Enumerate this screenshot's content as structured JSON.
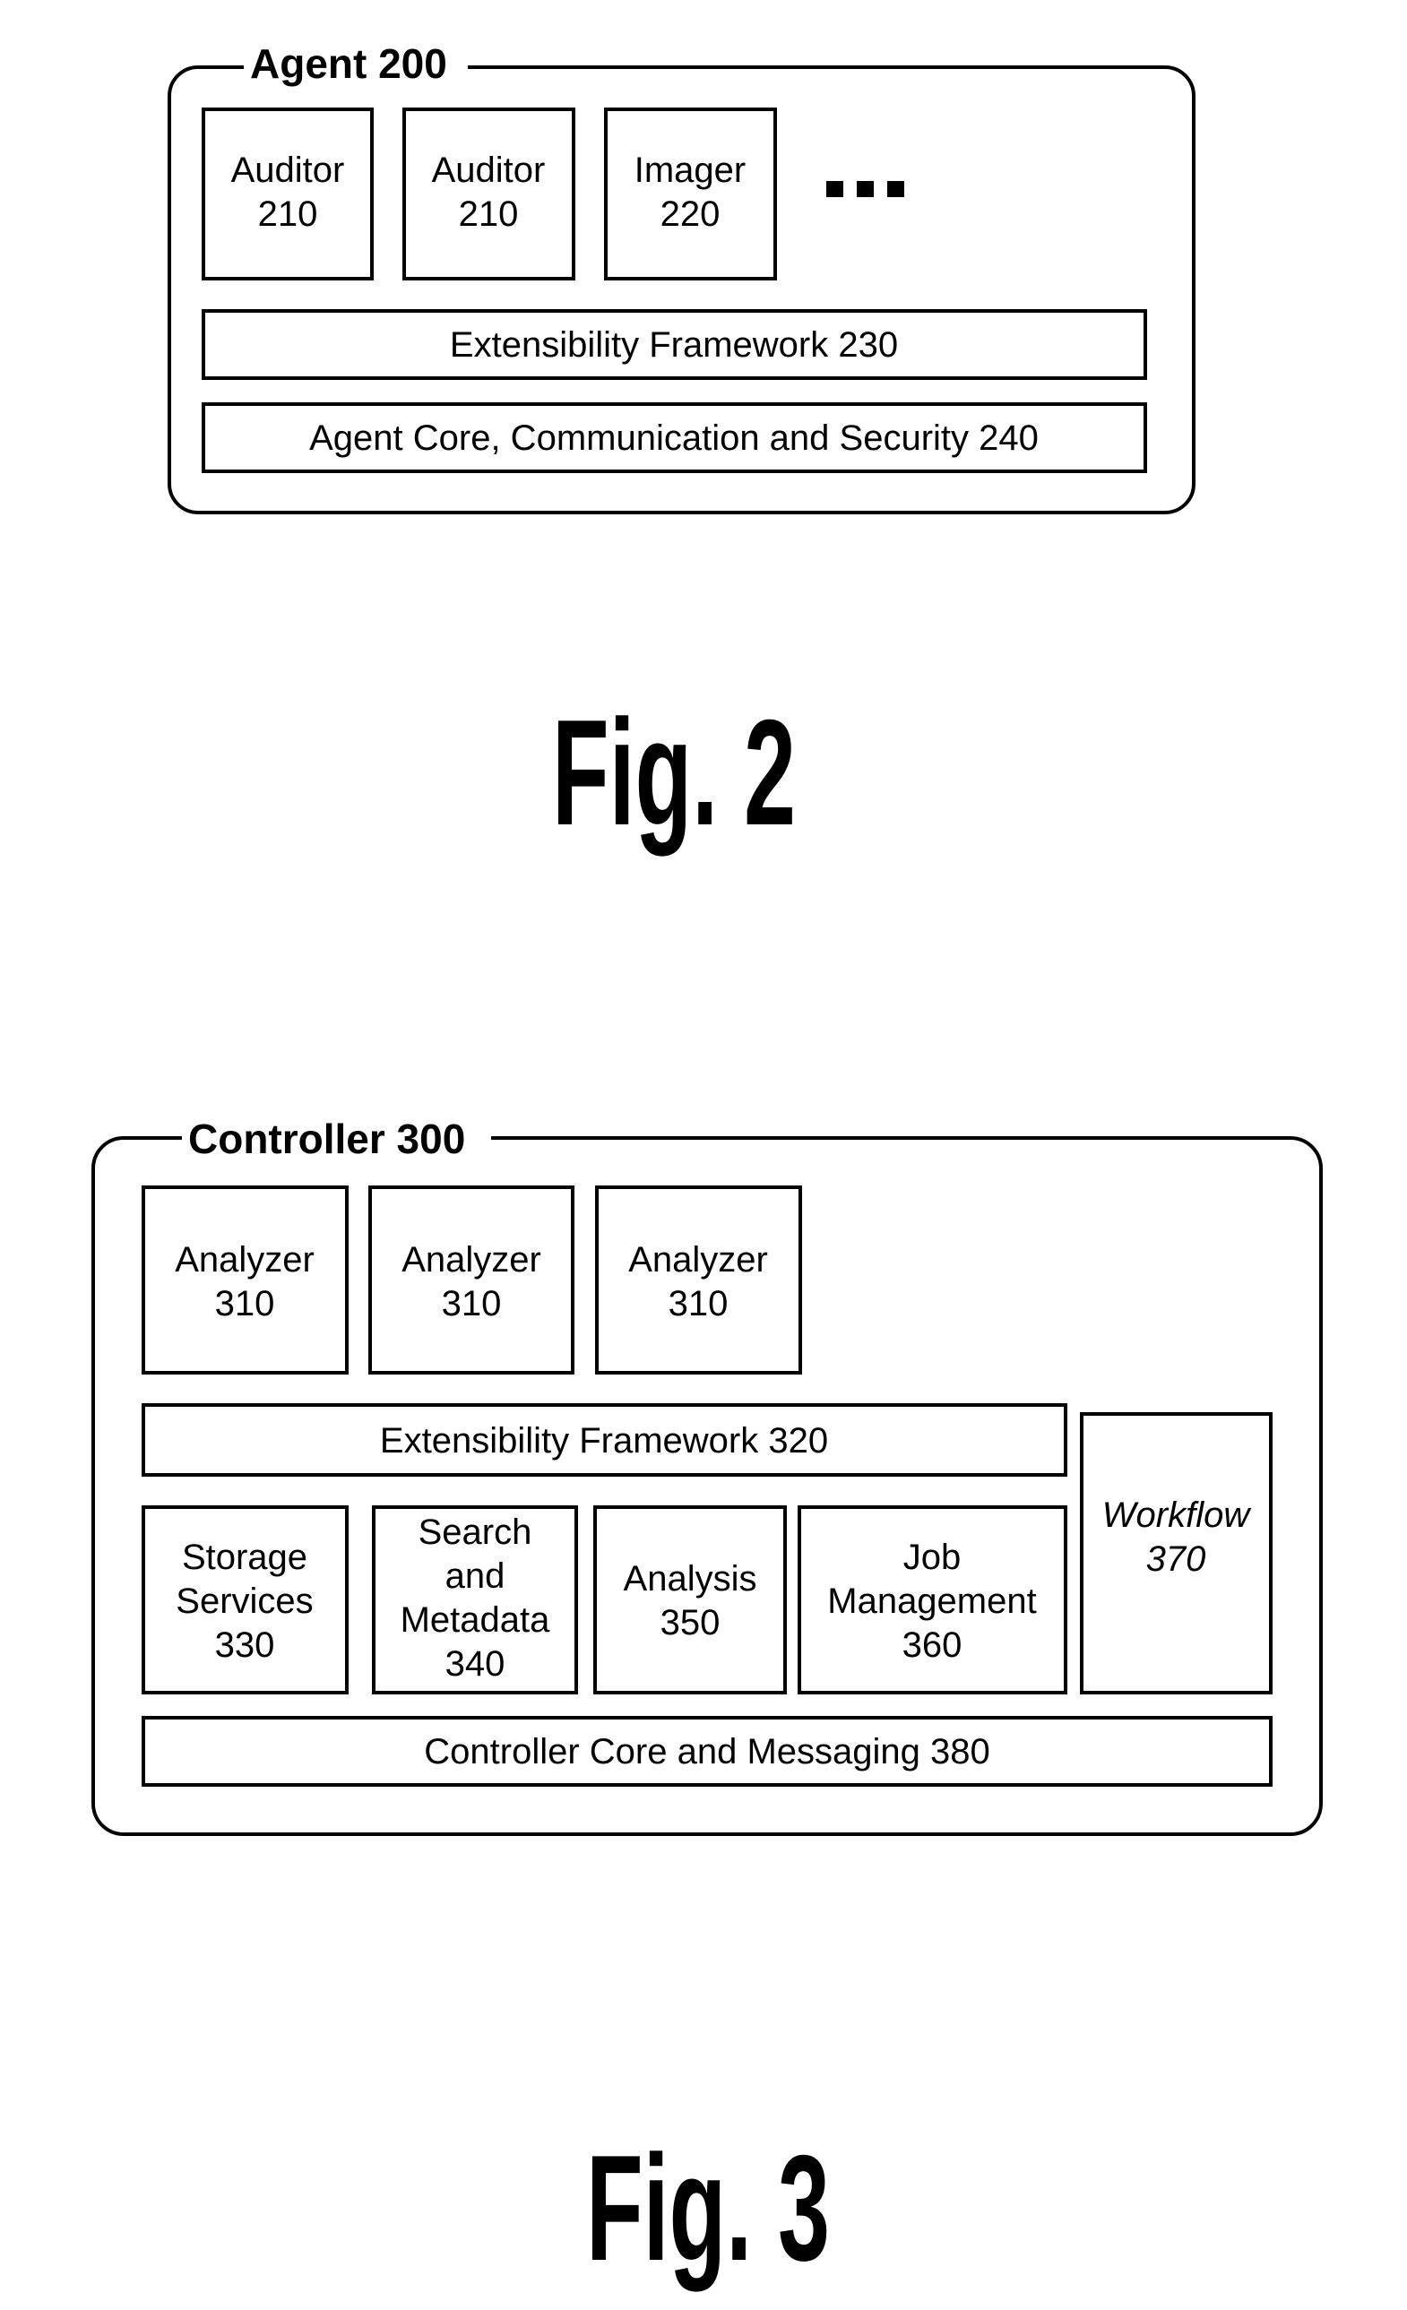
{
  "fig2": {
    "caption": "Fig. 2",
    "container": {
      "title": "Agent 200"
    },
    "modules": [
      {
        "lines": [
          "Auditor",
          "210"
        ]
      },
      {
        "lines": [
          "Auditor",
          "210"
        ]
      },
      {
        "lines": [
          "Imager",
          "220"
        ]
      }
    ],
    "more_indicator": "ellipsis",
    "layers": [
      {
        "label": "Extensibility Framework 230"
      },
      {
        "label": "Agent Core, Communication and Security 240"
      }
    ]
  },
  "fig3": {
    "caption": "Fig. 3",
    "container": {
      "title": "Controller 300"
    },
    "analyzers": [
      {
        "lines": [
          "Analyzer",
          "310"
        ]
      },
      {
        "lines": [
          "Analyzer",
          "310"
        ]
      },
      {
        "lines": [
          "Analyzer",
          "310"
        ]
      }
    ],
    "extensibility": {
      "label": "Extensibility Framework 320"
    },
    "services": [
      {
        "lines": [
          "Storage",
          "Services",
          "330"
        ]
      },
      {
        "lines": [
          "Search",
          "and",
          "Metadata",
          "340"
        ]
      },
      {
        "lines": [
          "Analysis",
          "350"
        ]
      },
      {
        "lines": [
          "Job",
          "Management",
          "360"
        ]
      }
    ],
    "workflow": {
      "lines": [
        "Workflow",
        "370"
      ],
      "italic": true
    },
    "core": {
      "label": "Controller Core and Messaging 380"
    }
  }
}
